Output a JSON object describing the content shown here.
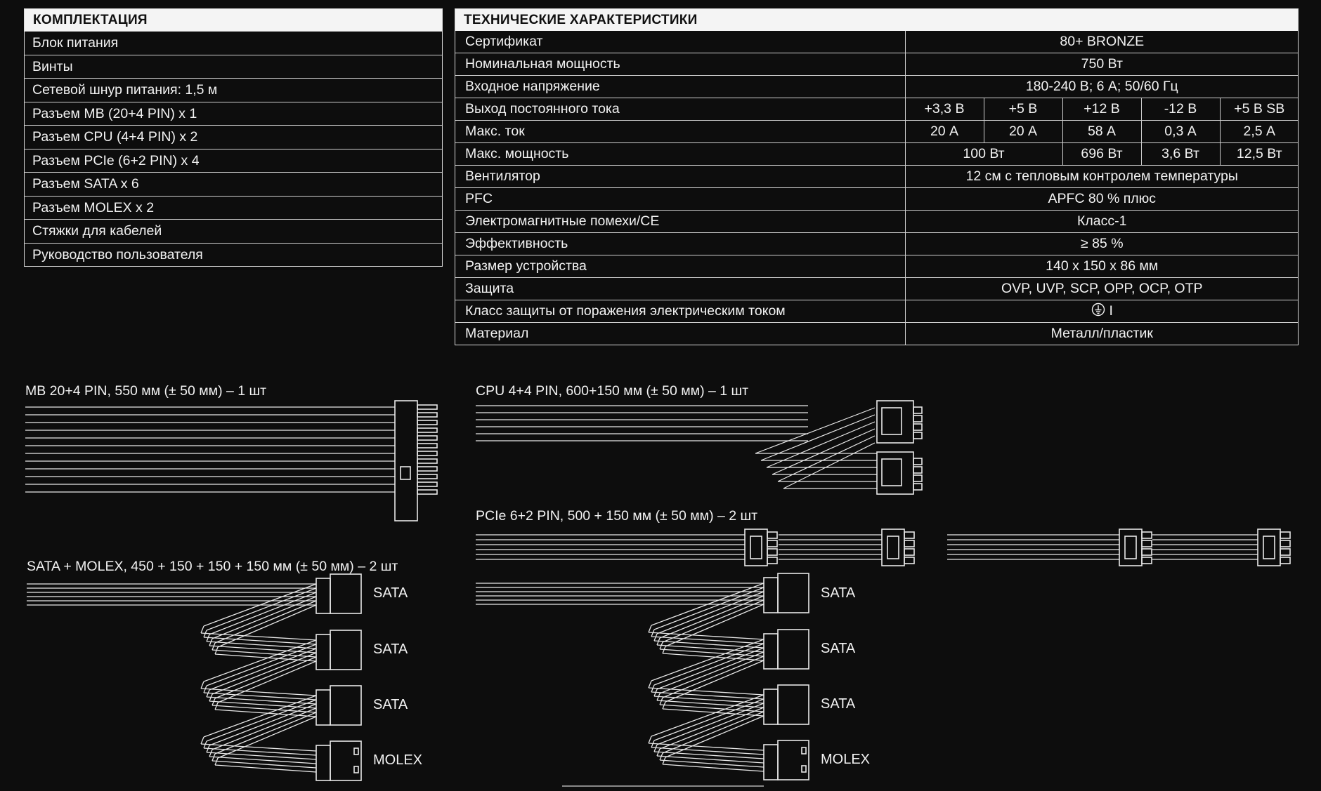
{
  "kit": {
    "title": "КОМПЛЕКТАЦИЯ",
    "items": [
      "Блок питания",
      "Винты",
      "Сетевой шнур питания: 1,5 м",
      "Разъем MB (20+4 PIN) x 1",
      "Разъем CPU (4+4 PIN) x 2",
      "Разъем PCIe (6+2 PIN) x 4",
      "Разъем SATA x 6",
      "Разъем MOLEX x 2",
      "Стяжки для кабелей",
      "Руководство пользователя"
    ]
  },
  "specs": {
    "title": "ТЕХНИЧЕСКИЕ ХАРАКТЕРИСТИКИ",
    "certificate": {
      "label": "Сертификат",
      "value": "80+ BRONZE"
    },
    "nominal_power": {
      "label": "Номинальная мощность",
      "value": "750 Вт"
    },
    "input_voltage": {
      "label": "Входное напряжение",
      "value": "180-240 В; 6 А; 50/60 Гц"
    },
    "dc_output": {
      "label": "Выход постоянного тока",
      "values": [
        "+3,3 В",
        "+5 В",
        "+12 В",
        "-12 В",
        "+5 В SB"
      ]
    },
    "max_current": {
      "label": "Макс. ток",
      "values": [
        "20 А",
        "20 А",
        "58 А",
        "0,3 А",
        "2,5 А"
      ]
    },
    "max_power": {
      "label": "Макс. мощность",
      "combined": "100 Вт",
      "values": [
        "696 Вт",
        "3,6 Вт",
        "12,5 Вт"
      ]
    },
    "fan": {
      "label": "Вентилятор",
      "value": "12 см с тепловым контролем температуры"
    },
    "pfc": {
      "label": "PFC",
      "value": "APFC 80 % плюс"
    },
    "emi": {
      "label": "Электромагнитные помехи/CE",
      "value": "Класс-1"
    },
    "efficiency": {
      "label": "Эффективность",
      "value": "≥ 85 %"
    },
    "size": {
      "label": "Размер устройства",
      "value": "140 x 150 x 86 мм"
    },
    "protection": {
      "label": "Защита",
      "value": "OVP, UVP, SCP, OPP, OCP, OTP"
    },
    "shock_class": {
      "label": "Класс защиты от поражения электрическим током",
      "value": "I"
    },
    "material": {
      "label": "Материал",
      "value": "Металл/пластик"
    }
  },
  "cables": {
    "mb": "MB 20+4 PIN, 550 мм (± 50 мм) – 1 шт",
    "cpu": "CPU 4+4 PIN, 600+150 мм (± 50 мм) – 1 шт",
    "pcie": "PCIe 6+2 PIN, 500 + 150 мм (± 50 мм) – 2 шт",
    "sata_molex": "SATA + MOLEX, 450 + 150 + 150 + 150 мм (± 50 мм) – 2 шт",
    "connector_labels": {
      "sata": "SATA",
      "molex": "MOLEX"
    }
  },
  "icons": {
    "shock_class": "protective-earth-icon"
  },
  "colors": {
    "background": "#0d0d0d",
    "foreground": "#f2f2f2",
    "header_bg": "#f4f4f4"
  }
}
